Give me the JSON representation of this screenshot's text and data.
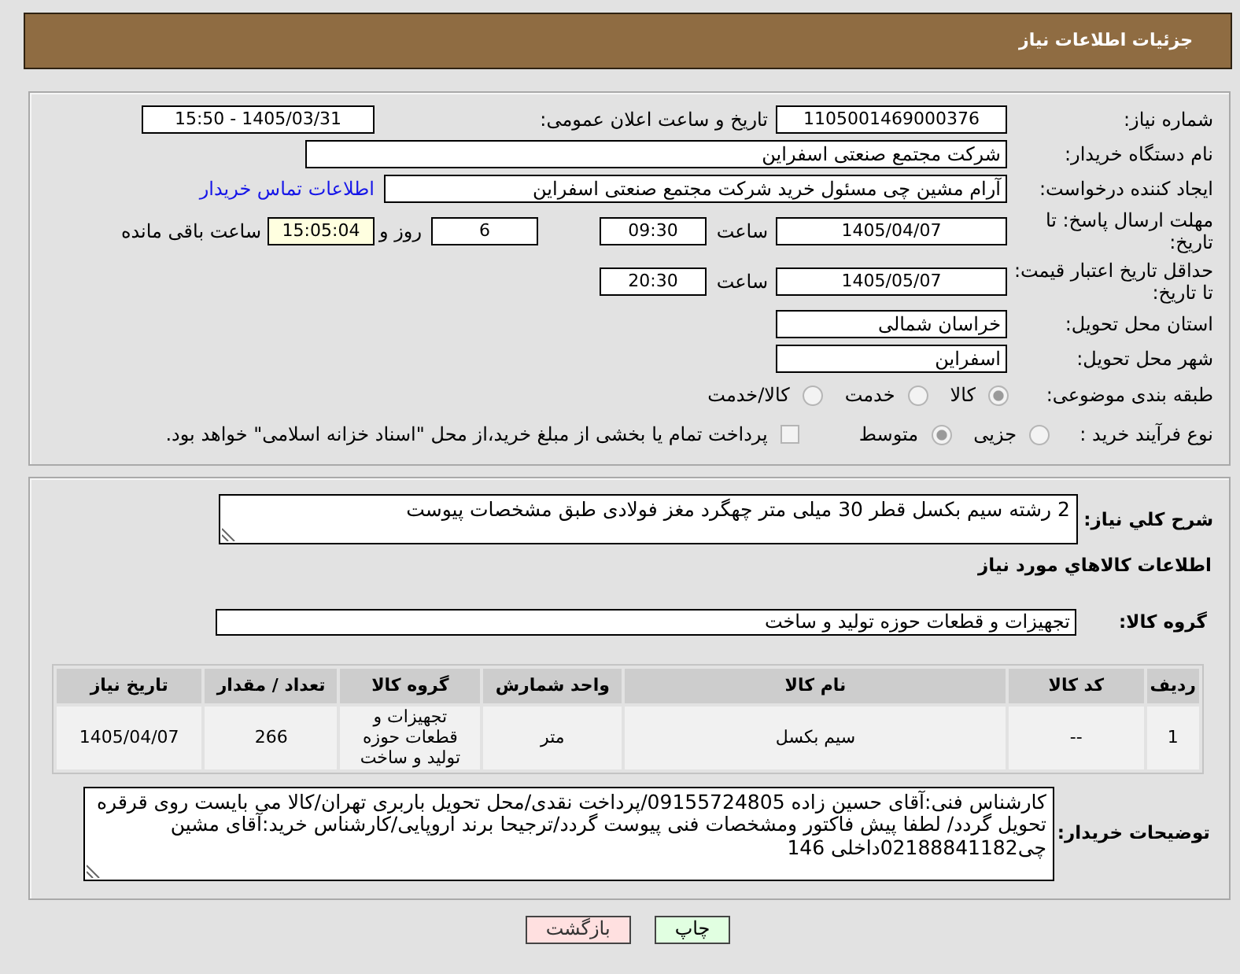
{
  "header": {
    "title": "جزئیات اطلاعات نیاز"
  },
  "details": {
    "need_number": {
      "label": "شماره نیاز:",
      "value": "1105001469000376"
    },
    "announcement": {
      "label": "تاریخ و ساعت اعلان عمومی:",
      "value": "1405/03/31 - 15:50"
    },
    "buyer_organization": {
      "label": "نام دستگاه خریدار:",
      "value": "شرکت مجتمع صنعتی اسفراین"
    },
    "requester": {
      "label": "ایجاد کننده درخواست:",
      "value": "آرام مشین چی مسئول خرید شرکت مجتمع صنعتی اسفراین",
      "contact_link": "اطلاعات تماس خریدار"
    },
    "reply_deadline": {
      "label": "مهلت ارسال پاسخ: تا تاریخ:",
      "date": "1405/04/07",
      "time_label": "ساعت",
      "time": "09:30",
      "days": "6",
      "days_label": "روز و",
      "remaining": "15:05:04",
      "remaining_label": "ساعت باقی مانده"
    },
    "price_validity": {
      "label": "حداقل تاریخ اعتبار قیمت: تا تاریخ:",
      "date": "1405/05/07",
      "time_label": "ساعت",
      "time": "20:30"
    },
    "delivery_province": {
      "label": "استان محل تحویل:",
      "value": "خراسان شمالی"
    },
    "delivery_city": {
      "label": "شهر محل تحویل:",
      "value": "اسفراین"
    },
    "category": {
      "label": "طبقه بندی موضوعی:",
      "options": [
        {
          "label": "کالا",
          "selected": true
        },
        {
          "label": "خدمت",
          "selected": false
        },
        {
          "label": "کالا/خدمت",
          "selected": false
        }
      ]
    },
    "process_type": {
      "label": "نوع فرآیند خرید :",
      "options": [
        {
          "label": "جزیی",
          "selected": false
        },
        {
          "label": "متوسط",
          "selected": true
        }
      ],
      "treasury_payment": {
        "label": "پرداخت تمام یا بخشی از مبلغ خرید،از محل \"اسناد خزانه اسلامی\" خواهد بود.",
        "checked": false
      }
    }
  },
  "needs": {
    "summary_label": "شرح کلي نياز:",
    "summary": "2 رشته سیم بکسل قطر 30 میلی متر چهگرد مغز فولادی طبق مشخصات پیوست",
    "goods_title": "اطلاعات کالاهاي مورد نياز",
    "group_label": "گروه کالا:",
    "group": "تجهیزات و قطعات حوزه تولید و ساخت",
    "table": {
      "columns": [
        "ردیف",
        "کد کالا",
        "نام کالا",
        "واحد شمارش",
        "گروه کالا",
        "تعداد / مقدار",
        "تاریخ نیاز"
      ],
      "rows": [
        [
          "1",
          "--",
          "سیم بکسل",
          "متر",
          "تجهیزات و قطعات حوزه تولید و ساخت",
          "266",
          "1405/04/07"
        ]
      ]
    },
    "notes_label": "توضیحات خریدار:",
    "notes": "کارشناس فنی:آقای حسین زاده 09155724805/پرداخت نقدی/محل تحویل باربری تهران/کالا می بایست روی قرقره تحویل گردد/ لطفا پیش فاکتور ومشخصات فنی پیوست گردد/ترجیحا برند اروپایی/کارشناس خرید:آقای مشین چی02188841182داخلی 146"
  },
  "buttons": [
    {
      "label": "چاپ",
      "kind": "print"
    },
    {
      "label": "بازگشت",
      "kind": "back"
    }
  ]
}
